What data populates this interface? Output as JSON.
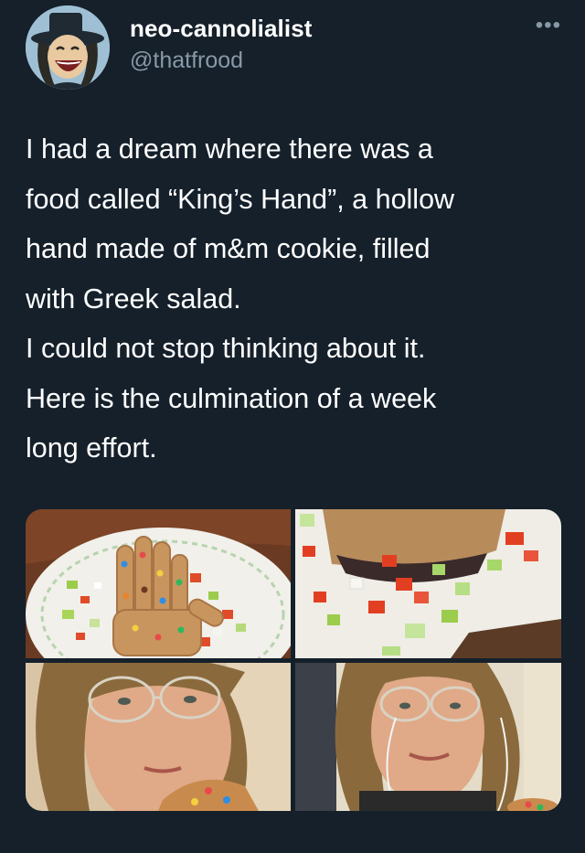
{
  "user": {
    "display_name": "neo-cannolialist",
    "handle": "@thatfrood"
  },
  "more_icon": "more-horizontal-icon",
  "tweet": {
    "lines": [
      "I had a dream where there was a",
      "food called “King’s Hand”, a hollow",
      "hand made of m&m cookie, filled",
      "with Greek salad.",
      "I could not stop thinking about it.",
      "Here is the culmination of a week",
      "long effort."
    ]
  },
  "media": {
    "count": 4
  },
  "colors": {
    "background": "#15202b",
    "text": "#ffffff",
    "secondary_text": "#8899a6"
  }
}
